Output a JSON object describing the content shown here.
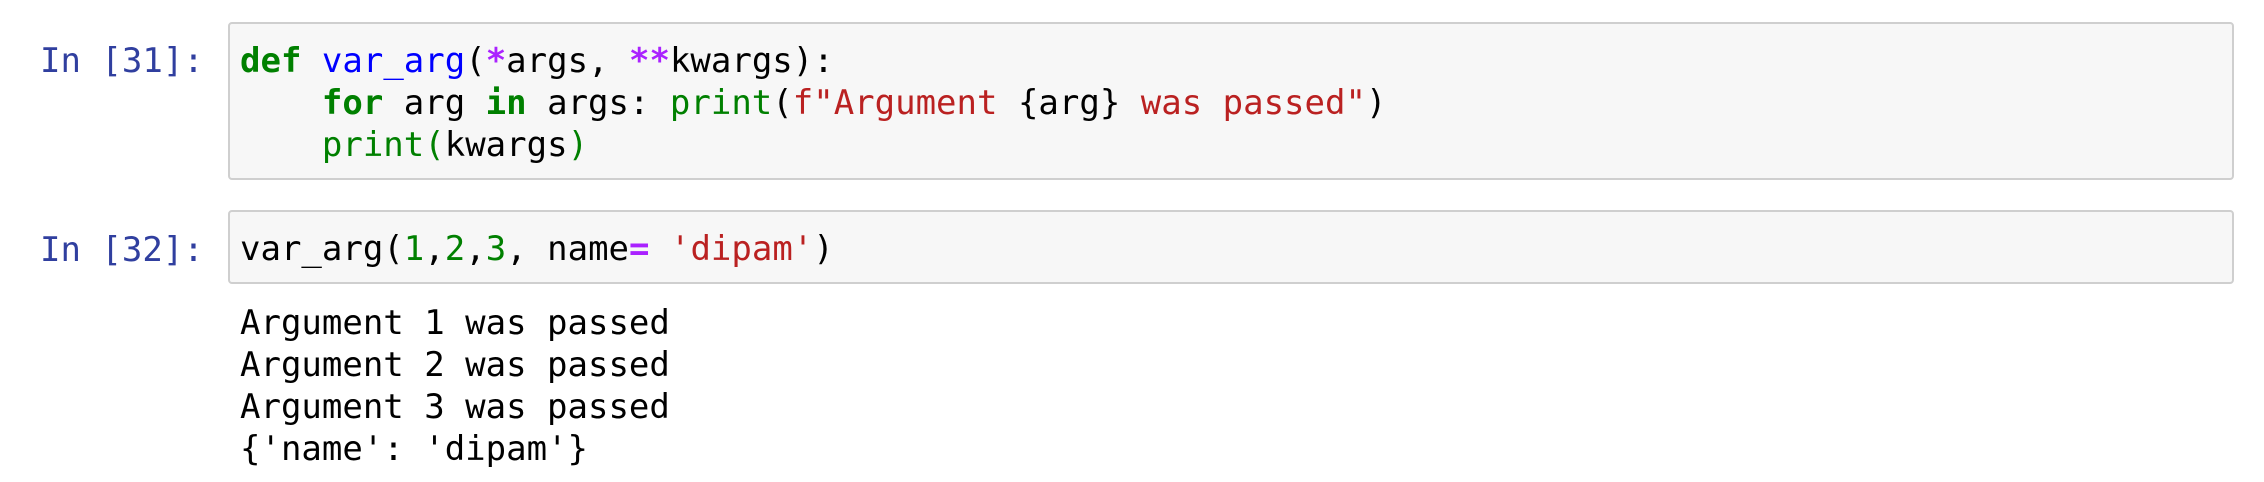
{
  "cells": [
    {
      "prompt": "In [31]:",
      "code": {
        "line1": {
          "kw_def": "def",
          "fn_name": "var_arg",
          "p1": "(",
          "star1": "*",
          "args": "args, ",
          "star2": "**",
          "kwargs": "kwargs):"
        },
        "line2": {
          "indent": "    ",
          "kw_for": "for",
          "t1": " arg ",
          "kw_in": "in",
          "t2": " args: ",
          "print": "print",
          "t3": "(",
          "fstr1": "f\"Argument ",
          "interp": "{arg}",
          "fstr2": " was passed\"",
          "t4": ")"
        },
        "line3": {
          "indent": "    ",
          "print": "print",
          "p1": "(",
          "kwargs": "kwargs",
          "p2": ")"
        }
      }
    },
    {
      "prompt": "In [32]:",
      "code": {
        "line1": {
          "call": "var_arg(",
          "n1": "1",
          "c1": ",",
          "n2": "2",
          "c2": ",",
          "n3": "3",
          "t1": ", name",
          "eq": "=",
          "sp": " ",
          "str": "'dipam'",
          "close": ")"
        }
      },
      "output": [
        "Argument 1 was passed",
        "Argument 2 was passed",
        "Argument 3 was passed",
        "{'name': 'dipam'}"
      ]
    }
  ]
}
